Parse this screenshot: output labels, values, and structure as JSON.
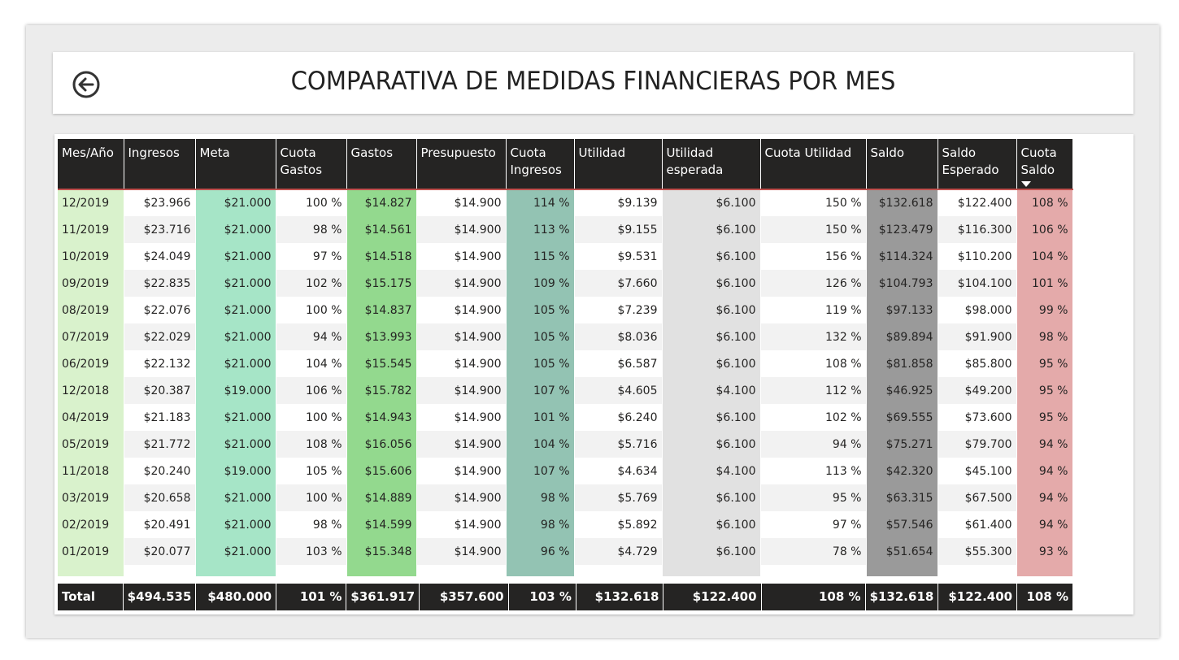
{
  "header": {
    "title": "COMPARATIVA DE MEDIDAS FINANCIERAS POR MES",
    "back_icon": "back-arrow-circle-icon"
  },
  "table": {
    "columns": [
      "Mes/Año",
      "Ingresos",
      "Meta",
      "Cuota Gastos",
      "Gastos",
      "Presupuesto",
      "Cuota Ingresos",
      "Utilidad",
      "Utilidad esperada",
      "Cuota Utilidad",
      "Saldo",
      "Saldo Esperado",
      "Cuota Saldo"
    ],
    "sorted_column": "Cuota Saldo",
    "sort_direction": "descending",
    "rows": [
      [
        "12/2019",
        "$23.966",
        "$21.000",
        "100 %",
        "$14.827",
        "$14.900",
        "114 %",
        "$9.139",
        "$6.100",
        "150 %",
        "$132.618",
        "$122.400",
        "108 %"
      ],
      [
        "11/2019",
        "$23.716",
        "$21.000",
        "98 %",
        "$14.561",
        "$14.900",
        "113 %",
        "$9.155",
        "$6.100",
        "150 %",
        "$123.479",
        "$116.300",
        "106 %"
      ],
      [
        "10/2019",
        "$24.049",
        "$21.000",
        "97 %",
        "$14.518",
        "$14.900",
        "115 %",
        "$9.531",
        "$6.100",
        "156 %",
        "$114.324",
        "$110.200",
        "104 %"
      ],
      [
        "09/2019",
        "$22.835",
        "$21.000",
        "102 %",
        "$15.175",
        "$14.900",
        "109 %",
        "$7.660",
        "$6.100",
        "126 %",
        "$104.793",
        "$104.100",
        "101 %"
      ],
      [
        "08/2019",
        "$22.076",
        "$21.000",
        "100 %",
        "$14.837",
        "$14.900",
        "105 %",
        "$7.239",
        "$6.100",
        "119 %",
        "$97.133",
        "$98.000",
        "99 %"
      ],
      [
        "07/2019",
        "$22.029",
        "$21.000",
        "94 %",
        "$13.993",
        "$14.900",
        "105 %",
        "$8.036",
        "$6.100",
        "132 %",
        "$89.894",
        "$91.900",
        "98 %"
      ],
      [
        "06/2019",
        "$22.132",
        "$21.000",
        "104 %",
        "$15.545",
        "$14.900",
        "105 %",
        "$6.587",
        "$6.100",
        "108 %",
        "$81.858",
        "$85.800",
        "95 %"
      ],
      [
        "12/2018",
        "$20.387",
        "$19.000",
        "106 %",
        "$15.782",
        "$14.900",
        "107 %",
        "$4.605",
        "$4.100",
        "112 %",
        "$46.925",
        "$49.200",
        "95 %"
      ],
      [
        "04/2019",
        "$21.183",
        "$21.000",
        "100 %",
        "$14.943",
        "$14.900",
        "101 %",
        "$6.240",
        "$6.100",
        "102 %",
        "$69.555",
        "$73.600",
        "95 %"
      ],
      [
        "05/2019",
        "$21.772",
        "$21.000",
        "108 %",
        "$16.056",
        "$14.900",
        "104 %",
        "$5.716",
        "$6.100",
        "94 %",
        "$75.271",
        "$79.700",
        "94 %"
      ],
      [
        "11/2018",
        "$20.240",
        "$19.000",
        "105 %",
        "$15.606",
        "$14.900",
        "107 %",
        "$4.634",
        "$4.100",
        "113 %",
        "$42.320",
        "$45.100",
        "94 %"
      ],
      [
        "03/2019",
        "$20.658",
        "$21.000",
        "100 %",
        "$14.889",
        "$14.900",
        "98 %",
        "$5.769",
        "$6.100",
        "95 %",
        "$63.315",
        "$67.500",
        "94 %"
      ],
      [
        "02/2019",
        "$20.491",
        "$21.000",
        "98 %",
        "$14.599",
        "$14.900",
        "98 %",
        "$5.892",
        "$6.100",
        "97 %",
        "$57.546",
        "$61.400",
        "94 %"
      ],
      [
        "01/2019",
        "$20.077",
        "$21.000",
        "103 %",
        "$15.348",
        "$14.900",
        "96 %",
        "$4.729",
        "$6.100",
        "78 %",
        "$51.654",
        "$55.300",
        "93 %"
      ]
    ],
    "totals": [
      "Total",
      "$494.535",
      "$480.000",
      "101 %",
      "$361.917",
      "$357.600",
      "103 %",
      "$132.618",
      "$122.400",
      "108 %",
      "$132.618",
      "$122.400",
      "108 %"
    ]
  },
  "scrollbar": {
    "up_glyph": "˄",
    "down_glyph": "˅"
  },
  "colors": {
    "header_bg": "#252423",
    "mes_col": "#d9f2cc",
    "meta_col": "#a6e5c7",
    "gastos_col": "#93d98e",
    "cuota_ingresos_col": "#93c3b3",
    "utilidad_esperada_col": "#e1e1e1",
    "saldo_col": "#9a9a9a",
    "cuota_saldo_col": "#e4aaaa"
  }
}
